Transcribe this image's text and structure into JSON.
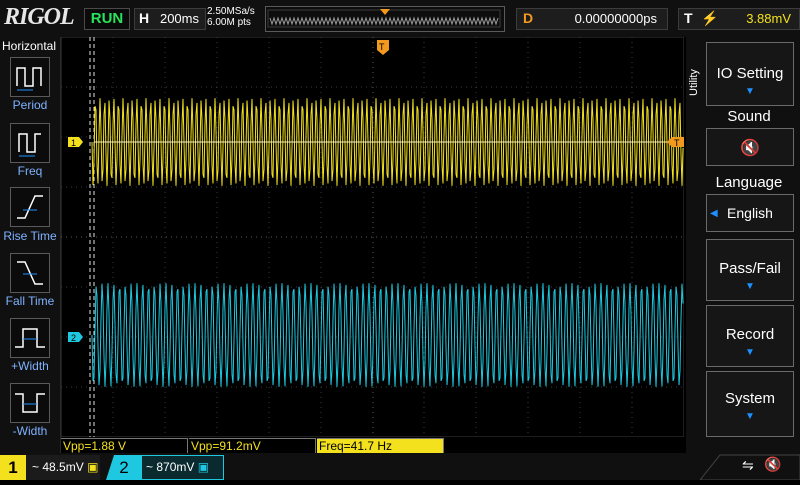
{
  "header": {
    "brand": "RIGOL",
    "run_state": "RUN",
    "horizontal_key": "H",
    "timebase": "200ms",
    "sample_rate": "2.50MSa/s",
    "memory_depth": "6.00M pts",
    "delay_key": "D",
    "delay_value": "0.00000000ps",
    "trigger_key": "T",
    "trigger_level": "3.88mV"
  },
  "left_panel": {
    "title": "Horizontal",
    "items": [
      {
        "label": "Period"
      },
      {
        "label": "Freq"
      },
      {
        "label": "Rise Time"
      },
      {
        "label": "Fall Time"
      },
      {
        "label": "+Width"
      },
      {
        "label": "-Width"
      }
    ]
  },
  "right_menu": {
    "header": "Utility",
    "buttons": [
      {
        "label": "IO Setting"
      },
      {
        "title": "Sound"
      },
      {
        "title": "Language",
        "value": "English"
      },
      {
        "label": "Pass/Fail"
      },
      {
        "label": "Record"
      },
      {
        "label": "System"
      }
    ]
  },
  "markers": {
    "ch1": "1",
    "ch2": "2",
    "trigger_pos": "T",
    "trigger_level": "T"
  },
  "measurements": [
    {
      "text": "Vpp=1.88 V"
    },
    {
      "text": "Vpp=91.2mV"
    },
    {
      "text": "Freq=41.7 Hz"
    }
  ],
  "channels": [
    {
      "number": "1",
      "coupling": "~",
      "scale": "48.5mV",
      "color": "#f3e11e"
    },
    {
      "number": "2",
      "coupling": "~",
      "scale": "870mV",
      "color": "#1ec8e0"
    }
  ],
  "colors": {
    "ch1": "#f3e11e",
    "ch2": "#1ec8e0",
    "trigger": "#f39a1e",
    "accent": "#1e90ff"
  }
}
